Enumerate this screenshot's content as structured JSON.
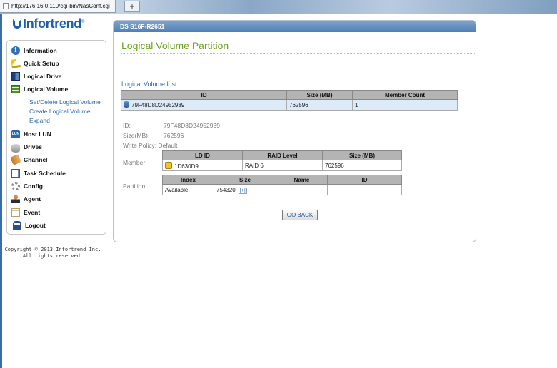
{
  "browser": {
    "url": "http://176.16.0.110/cgi-bin/NasConf.cgi",
    "new_tab_label": "+"
  },
  "logo": {
    "text": "Infortrend",
    "mark": "®"
  },
  "sidebar": {
    "items": [
      {
        "label": "Information",
        "icon": "info-icon"
      },
      {
        "label": "Quick Setup",
        "icon": "wand-icon"
      },
      {
        "label": "Logical Drive",
        "icon": "logical-drive-icon"
      },
      {
        "label": "Logical Volume",
        "icon": "logical-volume-icon"
      },
      {
        "label": "Host LUN",
        "icon": "lun-icon"
      },
      {
        "label": "Drives",
        "icon": "drive-icon"
      },
      {
        "label": "Channel",
        "icon": "channel-icon"
      },
      {
        "label": "Task Schedule",
        "icon": "calendar-icon"
      },
      {
        "label": "Config",
        "icon": "gear-icon"
      },
      {
        "label": "Agent",
        "icon": "agent-icon"
      },
      {
        "label": "Event",
        "icon": "event-log-icon"
      },
      {
        "label": "Logout",
        "icon": "logout-icon"
      }
    ],
    "sub_items": [
      "Set/Delete Logical Volume",
      "Create Logical Volume",
      "Expand"
    ]
  },
  "copyright": {
    "line1": "Copyright © 2013 Infortrend Inc.",
    "line2": "All rights reserved."
  },
  "panel": {
    "header": "DS S16F-R2651",
    "title": "Logical Volume Partition",
    "list_title": "Logical Volume List",
    "list_columns": [
      "ID",
      "Size (MB)",
      "Member Count"
    ],
    "list_rows": [
      {
        "id": "79F48D8D24952939",
        "size": "762596",
        "members": "1"
      }
    ],
    "details": {
      "id_label": "ID:",
      "id_value": "79F48D8D24952939",
      "size_label": "Size(MB):",
      "size_value": "762596",
      "write_policy": "Write Policy: Default",
      "member_label": "Member:",
      "partition_label": "Partition:"
    },
    "member_columns": [
      "LD ID",
      "RAID Level",
      "Size (MB)"
    ],
    "member_rows": [
      {
        "ld_id": "1D630D9",
        "raid": "RAID 6",
        "size": "762596"
      }
    ],
    "partition_columns": [
      "Index",
      "Size",
      "Name",
      "ID"
    ],
    "partition_rows": [
      {
        "index": "Available",
        "size": "754320",
        "add": "[+]",
        "name": "",
        "id": ""
      }
    ],
    "go_back": "GO BACK"
  }
}
